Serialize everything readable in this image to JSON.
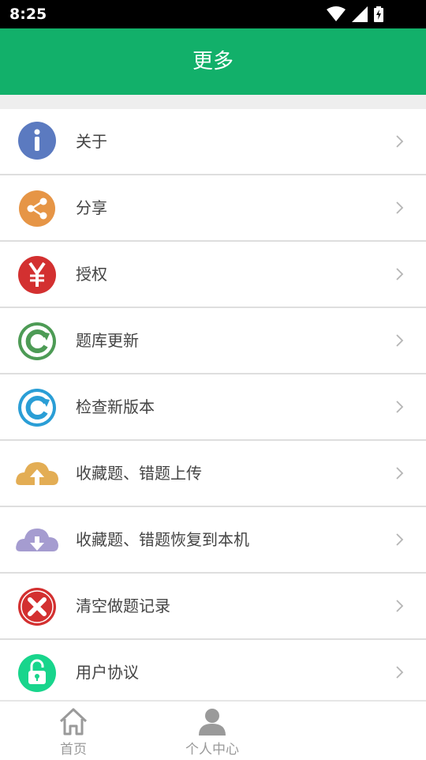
{
  "status_bar": {
    "time": "8:25"
  },
  "app_bar": {
    "title": "更多"
  },
  "menu": {
    "items": [
      {
        "label": "关于",
        "icon": "info-icon",
        "color": "#5b7ac0"
      },
      {
        "label": "分享",
        "icon": "share-icon",
        "color": "#e69546"
      },
      {
        "label": "授权",
        "icon": "yen-icon",
        "color": "#d33030"
      },
      {
        "label": "题库更新",
        "icon": "refresh-icon",
        "color": "#4d9b55"
      },
      {
        "label": "检查新版本",
        "icon": "update-icon",
        "color": "#2a9ed6"
      },
      {
        "label": "收藏题、错题上传",
        "icon": "cloud-upload-icon",
        "color": "#e3ad54"
      },
      {
        "label": "收藏题、错题恢复到本机",
        "icon": "cloud-download-icon",
        "color": "#a59cd0"
      },
      {
        "label": "清空做题记录",
        "icon": "clear-icon",
        "color": "#d33030"
      },
      {
        "label": "用户协议",
        "icon": "lock-icon",
        "color": "#18d58c"
      }
    ]
  },
  "bottom_nav": {
    "tabs": [
      {
        "label": "首页",
        "icon": "home-icon"
      },
      {
        "label": "个人中心",
        "icon": "person-icon"
      }
    ]
  },
  "colors": {
    "primary": "#12b06a",
    "divider": "#dedede",
    "text": "#444444"
  }
}
